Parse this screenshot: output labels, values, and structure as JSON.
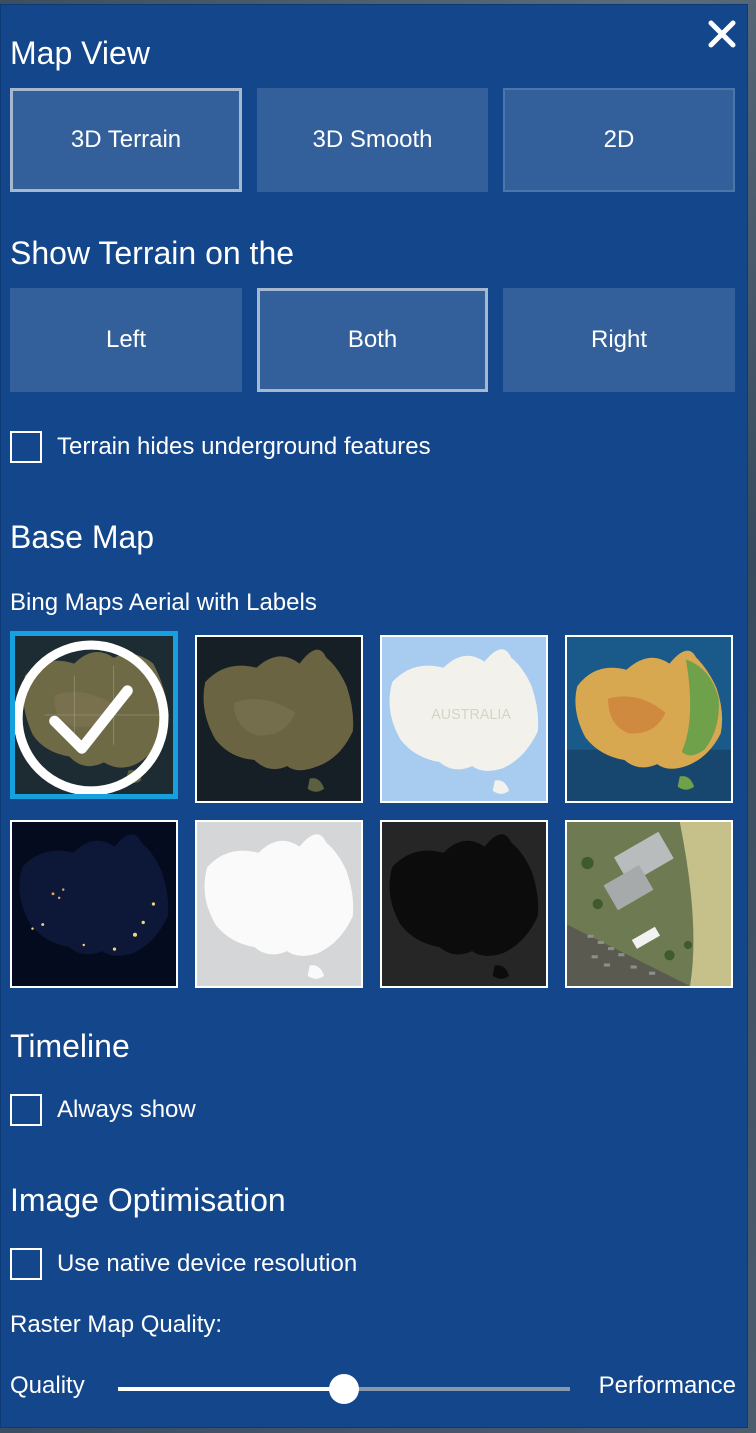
{
  "colors": {
    "panel_bg": "#13468a",
    "button_bg": "#33609a",
    "active_tile_border": "#16a0dd",
    "text": "#ffffff"
  },
  "close_icon": "close-icon",
  "map_view": {
    "title": "Map View",
    "options": [
      "3D Terrain",
      "3D Smooth",
      "2D"
    ],
    "selected": "3D Terrain"
  },
  "terrain_side": {
    "title": "Show Terrain on the",
    "options": [
      "Left",
      "Both",
      "Right"
    ],
    "selected": "Both"
  },
  "terrain_hides": {
    "label": "Terrain hides underground features",
    "checked": false
  },
  "base_map": {
    "title": "Base Map",
    "selected_label": "Bing Maps Aerial with Labels",
    "selected_index": 0,
    "tile_count": 8,
    "tile_label_text": "AUSTRALIA"
  },
  "timeline": {
    "title": "Timeline",
    "always_show_label": "Always show",
    "checked": false
  },
  "image_optimisation": {
    "title": "Image Optimisation",
    "native_resolution_label": "Use native device resolution",
    "checked": false,
    "raster_quality_label": "Raster Map Quality:",
    "slider_left_label": "Quality",
    "slider_right_label": "Performance",
    "slider_value": 0.5
  }
}
